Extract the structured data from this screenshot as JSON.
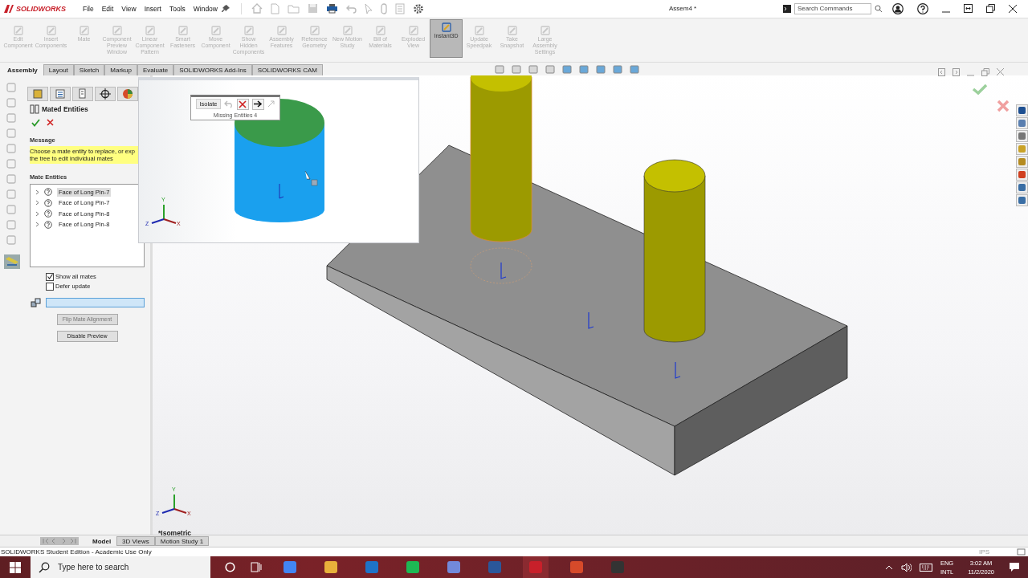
{
  "title_bar": {
    "logo": "SOLIDWORKS",
    "menu": [
      "File",
      "Edit",
      "View",
      "Insert",
      "Tools",
      "Window"
    ],
    "document_title": "Assem4 *",
    "search": {
      "placeholder": "Search Commands"
    }
  },
  "ribbon": [
    {
      "label": "Edit Component",
      "selected": false,
      "disabled": true
    },
    {
      "label": "Insert Components",
      "selected": false,
      "disabled": true
    },
    {
      "label": "Mate",
      "selected": false,
      "disabled": true
    },
    {
      "label": "Component Preview Window",
      "selected": false,
      "disabled": true
    },
    {
      "label": "Linear Component Pattern",
      "selected": false,
      "disabled": true
    },
    {
      "label": "Smart Fasteners",
      "selected": false,
      "disabled": true
    },
    {
      "label": "Move Component",
      "selected": false,
      "disabled": true
    },
    {
      "label": "Show Hidden Components",
      "selected": false,
      "disabled": true
    },
    {
      "label": "Assembly Features",
      "selected": false,
      "disabled": true
    },
    {
      "label": "Reference Geometry",
      "selected": false,
      "disabled": true
    },
    {
      "label": "New Motion Study",
      "selected": false,
      "disabled": true
    },
    {
      "label": "Bill of Materials",
      "selected": false,
      "disabled": true
    },
    {
      "label": "Exploded View",
      "selected": false,
      "disabled": true
    },
    {
      "label": "Instant3D",
      "selected": true,
      "disabled": false
    },
    {
      "label": "Update Speedpak",
      "selected": false,
      "disabled": true
    },
    {
      "label": "Take Snapshot",
      "selected": false,
      "disabled": true
    },
    {
      "label": "Large Assembly Settings",
      "selected": false,
      "disabled": true
    }
  ],
  "command_tabs": [
    {
      "label": "Assembly",
      "selected": true
    },
    {
      "label": "Layout",
      "selected": false
    },
    {
      "label": "Sketch",
      "selected": false
    },
    {
      "label": "Markup",
      "selected": false
    },
    {
      "label": "Evaluate",
      "selected": false
    },
    {
      "label": "SOLIDWORKS Add-Ins",
      "selected": false
    },
    {
      "label": "SOLIDWORKS CAM",
      "selected": false
    }
  ],
  "property_manager": {
    "title": "Mated Entities",
    "message_heading": "Message",
    "message_lines": [
      "Choose a mate entity to replace, or exp",
      "the tree to edit individual mates"
    ],
    "entities_heading": "Mate Entities",
    "entities": [
      {
        "label": "Face of Long Pin-7",
        "selected": true
      },
      {
        "label": "Face of Long Pin-7",
        "selected": false
      },
      {
        "label": "Face of Long Pin-8",
        "selected": false
      },
      {
        "label": "Face of Long Pin-8",
        "selected": false
      }
    ],
    "options": [
      {
        "label": "Show all mates",
        "checked": true
      },
      {
        "label": "Defer update",
        "checked": false
      }
    ],
    "buttons": [
      {
        "label": "Flip Mate Alignment",
        "disabled": true
      },
      {
        "label": "Disable Preview",
        "disabled": false
      }
    ]
  },
  "preview_window": {
    "isolate_button": "Isolate",
    "caption": "Missing Entities 4",
    "triad": {
      "x": "X",
      "y": "Y",
      "z": "Z"
    }
  },
  "viewport": {
    "triad": {
      "x": "X",
      "y": "Y",
      "z": "Z"
    },
    "view_name": "*Isometric"
  },
  "bottom_tabs": [
    {
      "label": "Model",
      "selected": true
    },
    {
      "label": "3D Views",
      "selected": false
    },
    {
      "label": "Motion Study 1",
      "selected": false
    }
  ],
  "status_bar": {
    "text": "SOLIDWORKS Student Edition - Academic Use Only",
    "units": "IPS"
  },
  "taskbar": {
    "search_placeholder": "Type here to search",
    "language": "ENG",
    "layout": "INTL",
    "time": "3:02 AM",
    "date": "11/2/2020"
  }
}
